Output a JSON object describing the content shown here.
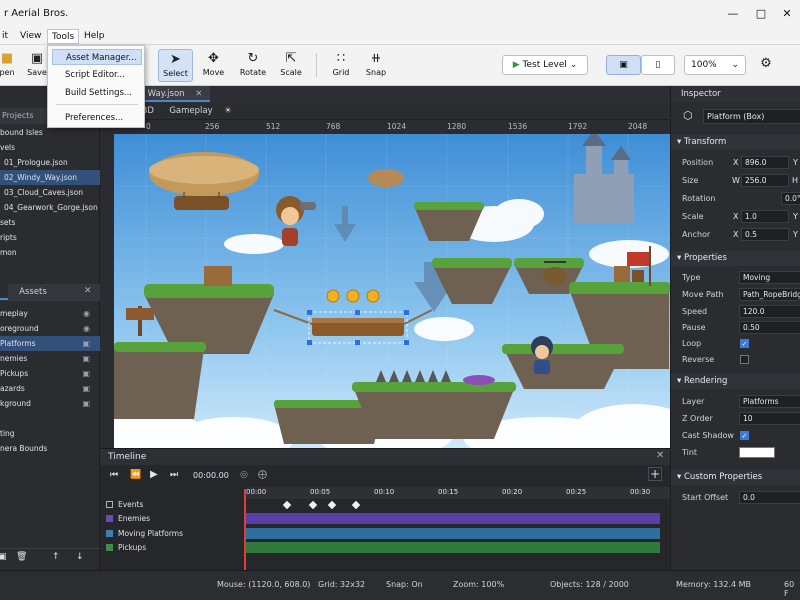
{
  "app": {
    "title": "r Aerial Bros."
  },
  "menu": [
    "it",
    "View",
    "Tools",
    "Help"
  ],
  "dropdown": [
    "Asset Manager...",
    "Script Editor...",
    "Build Settings...",
    "Preferences..."
  ],
  "toolbar": {
    "open": "pen",
    "save": "Save",
    "select": "Select",
    "move": "Move",
    "rotate": "Rotate",
    "scale": "Scale",
    "grid": "Grid",
    "snap": "Snap",
    "test_level": "Test Level",
    "zoom": "100%"
  },
  "projects": {
    "header": "Projects",
    "items": [
      "bound Isles",
      "vels",
      "01_Prologue.json",
      "02_Windy_Way.json",
      "03_Cloud_Caves.json",
      "04_Gearwork_Gorge.json",
      "sets",
      "ripts",
      "mon"
    ]
  },
  "layers_tabs": {
    "assets": "Assets"
  },
  "layers": [
    "meplay",
    "oreground",
    "Platforms",
    "nemies",
    "Pickups",
    "azards",
    "kground",
    "",
    "ting",
    "nera Bounds"
  ],
  "doc_tab": "Way.json",
  "view_tabs": {
    "mode3d": "3D",
    "gameplay": "Gameplay"
  },
  "ruler": [
    "0",
    "256",
    "512",
    "768",
    "1024",
    "1280",
    "1536",
    "1792",
    "2048"
  ],
  "timeline": {
    "title": "Timeline",
    "time": "00:00.00",
    "ticks": [
      "00:00",
      "00:05",
      "00:10",
      "00:15",
      "00:20",
      "00:25",
      "00:30"
    ],
    "tracks": [
      {
        "name": "Events",
        "color": "#9aa0a8"
      },
      {
        "name": "Enemies",
        "color": "#6a4bb8"
      },
      {
        "name": "Moving Platforms",
        "color": "#3e7fb0"
      },
      {
        "name": "Pickups",
        "color": "#3c8d4a"
      }
    ]
  },
  "inspector": {
    "header": "Inspector",
    "object": "Platform (Box)",
    "transform": "Transform",
    "position": "Position",
    "pos_x_l": "X",
    "pos_x": "896.0",
    "pos_y_l": "Y",
    "size": "Size",
    "size_w_l": "W",
    "size_w": "256.0",
    "size_h_l": "H",
    "rotation": "Rotation",
    "rotation_v": "0.0°",
    "scale": "Scale",
    "scale_x_l": "X",
    "scale_x": "1.0",
    "scale_y_l": "Y",
    "anchor": "Anchor",
    "anchor_x_l": "X",
    "anchor_x": "0.5",
    "anchor_y_l": "Y",
    "properties": "Properties",
    "type": "Type",
    "type_v": "Moving",
    "move_path": "Move Path",
    "move_path_v": "Path_RopeBridge",
    "speed": "Speed",
    "speed_v": "120.0",
    "pause": "Pause",
    "pause_v": "0.50",
    "loop": "Loop",
    "reverse": "Reverse",
    "rendering": "Rendering",
    "layer": "Layer",
    "layer_v": "Platforms",
    "z_order": "Z Order",
    "z_order_v": "10",
    "cast_shadow": "Cast Shadow",
    "tint": "Tint",
    "custom": "Custom Properties",
    "start_offset": "Start Offset",
    "start_offset_v": "0.0"
  },
  "status": {
    "mouse": "Mouse: (1120.0, 608.0)",
    "grid": "Grid: 32x32",
    "snap": "Snap: On",
    "zoom": "Zoom: 100%",
    "objects": "Objects: 128 / 2000",
    "memory": "Memory: 132.4 MB",
    "fps": "60 F"
  }
}
